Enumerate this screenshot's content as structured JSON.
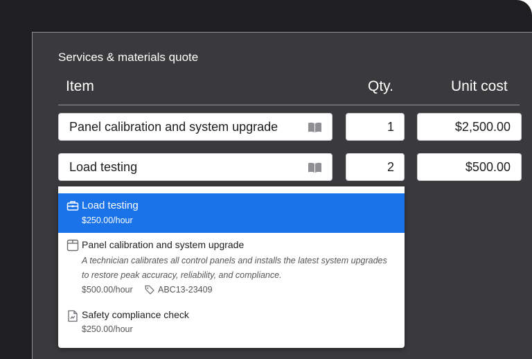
{
  "title": "Services & materials quote",
  "columns": {
    "item": "Item",
    "qty": "Qty.",
    "unit_cost": "Unit cost"
  },
  "rows": [
    {
      "item": "Panel calibration and system upgrade",
      "qty": "1",
      "unit_cost": "$2,500.00"
    },
    {
      "item": "Load testing",
      "qty": "2",
      "unit_cost": "$500.00"
    }
  ],
  "dropdown": {
    "options": [
      {
        "name": "Load testing",
        "price": "$250.00/hour",
        "icon": "toolbox-icon",
        "selected": true
      },
      {
        "name": "Panel calibration and system upgrade",
        "description": "A technician calibrates all control panels and installs the latest system upgrades to restore peak accuracy, reliability, and compliance.",
        "price": "$500.00/hour",
        "sku": "ABC13-23409",
        "icon": "package-icon"
      },
      {
        "name": "Safety compliance check",
        "price": "$250.00/hour",
        "icon": "document-icon"
      }
    ]
  },
  "colors": {
    "accent": "#1a73e8",
    "panel": "#3a3a3c",
    "background": "#1f1f21"
  }
}
